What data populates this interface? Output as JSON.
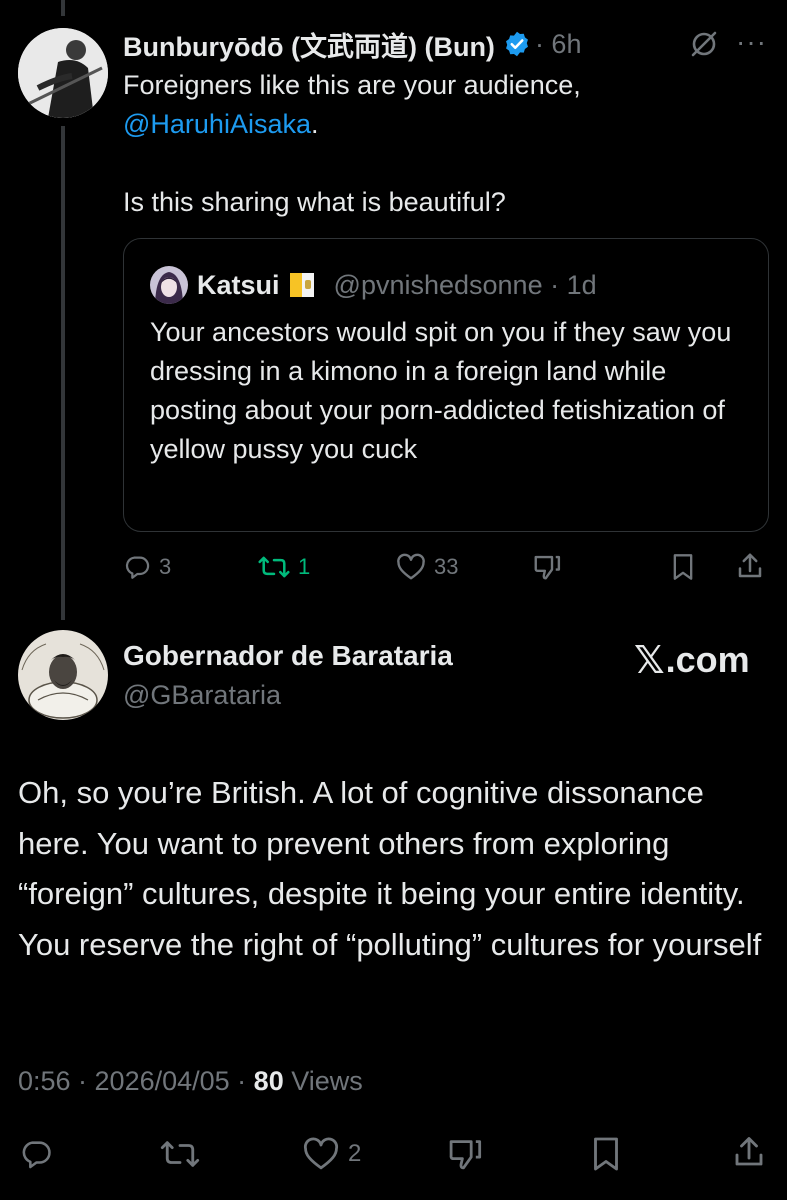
{
  "tweet1": {
    "display_name": "Bunburyōdō (文武両道) (Bun)",
    "time": "· 6h",
    "more_label": "···",
    "text_line1": "Foreigners like this are your audience,",
    "mention": "@HaruhiAisaka",
    "mention_suffix": ".",
    "text_line3": "Is this sharing what is beautiful?",
    "quote": {
      "display_name": "Katsui",
      "handle_time": "@pvnishedsonne · 1d",
      "text": "Your ancestors would spit on you if they saw you dressing in a kimono in a foreign land while posting about your porn-addicted fetishization of yellow pussy you cuck"
    },
    "actions": {
      "replies": "3",
      "reposts": "1",
      "likes": "33"
    }
  },
  "tweet2": {
    "display_name": "Gobernador de Barataria",
    "handle": "@GBarataria",
    "brand": ".com",
    "brand_logo": "𝕏",
    "text": "Oh, so you’re British. A lot of cognitive dissonance here. You want to prevent others from exploring “foreign” cultures, despite it being your entire identity. You reserve the right of “polluting” cultures for yourself",
    "meta_prefix": "0:56 · 2026/04/05 · ",
    "views_count": "80",
    "views_label": " Views",
    "actions": {
      "likes": "2"
    }
  },
  "colors": {
    "background": "#000000",
    "text": "#e7e9ea",
    "muted": "#71767b",
    "link": "#1d9bf0",
    "repost_active": "#00ba7c",
    "verified": "#1d9bf0",
    "border": "#2f3336"
  },
  "icons": [
    "reply-icon",
    "repost-icon",
    "like-icon",
    "downvote-icon",
    "bookmark-icon",
    "share-icon",
    "grok-icon",
    "more-icon",
    "verified-icon"
  ]
}
